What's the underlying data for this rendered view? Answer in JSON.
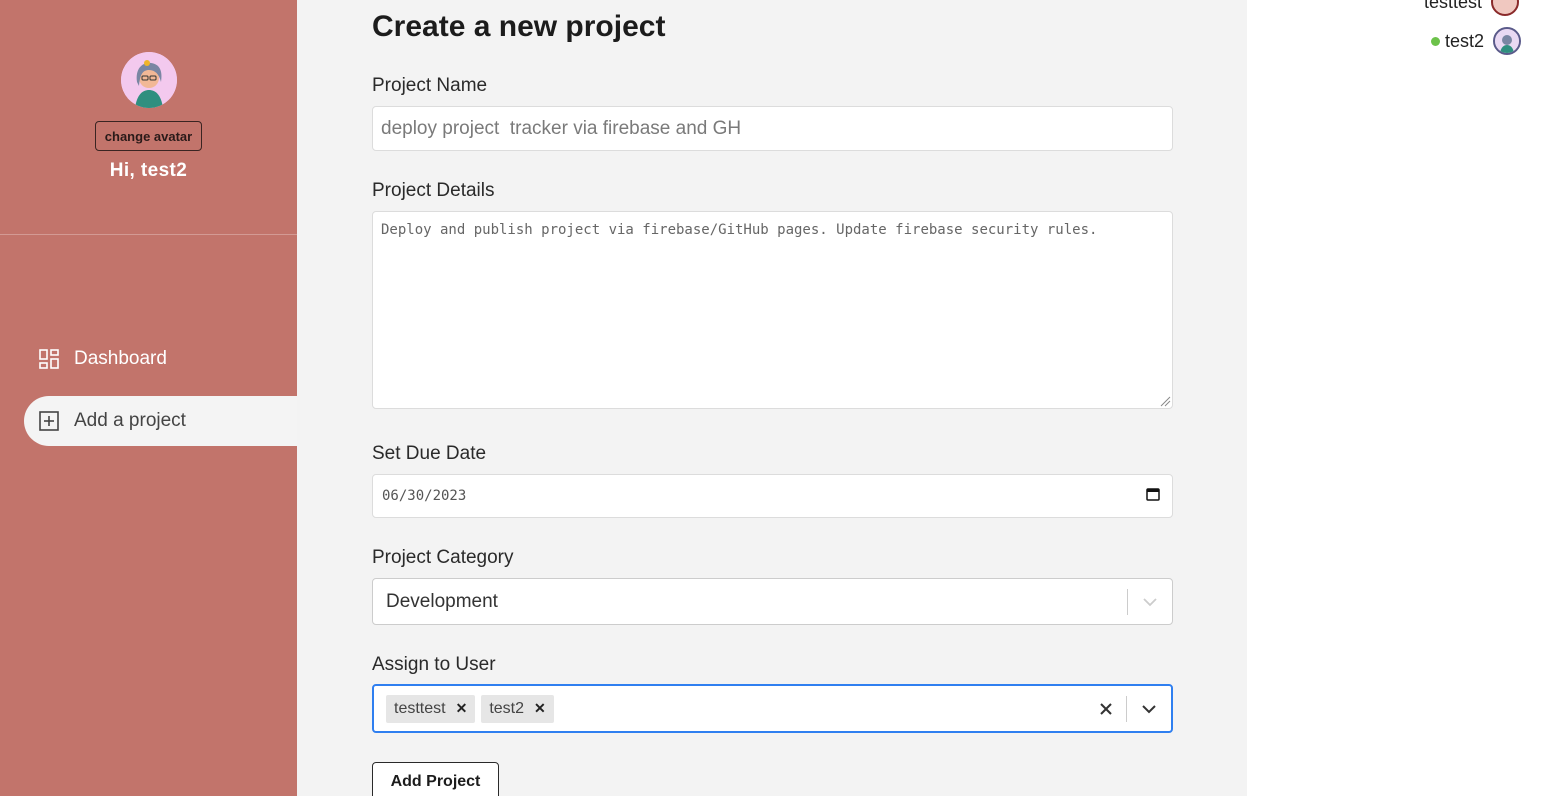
{
  "sidebar": {
    "change_avatar_label": "change avatar",
    "greeting": "Hi, test2",
    "nav": [
      {
        "label": "Dashboard",
        "icon": "dashboard-grid-icon",
        "active": false
      },
      {
        "label": "Add a project",
        "icon": "plus-square-icon",
        "active": true
      }
    ]
  },
  "form": {
    "title": "Create a new project",
    "name_label": "Project Name",
    "name_placeholder": "deploy project  tracker via firebase and GH",
    "details_label": "Project Details",
    "details_placeholder": "Deploy and publish project via firebase/GitHub pages. Update firebase security rules.",
    "due_label": "Set Due Date",
    "due_value": "06/30/2023",
    "category_label": "Project Category",
    "category_value": "Development",
    "assign_label": "Assign to User",
    "assigned_users": [
      "testtest",
      "test2"
    ],
    "submit_label": "Add Project"
  },
  "online_users": [
    {
      "name": "testtest",
      "online": false
    },
    {
      "name": "test2",
      "online": true
    }
  ],
  "colors": {
    "sidebar_bg": "#c2746b",
    "main_bg": "#f3f3f3",
    "focus_border": "#2f7ff0",
    "online_dot": "#6cc24a"
  }
}
